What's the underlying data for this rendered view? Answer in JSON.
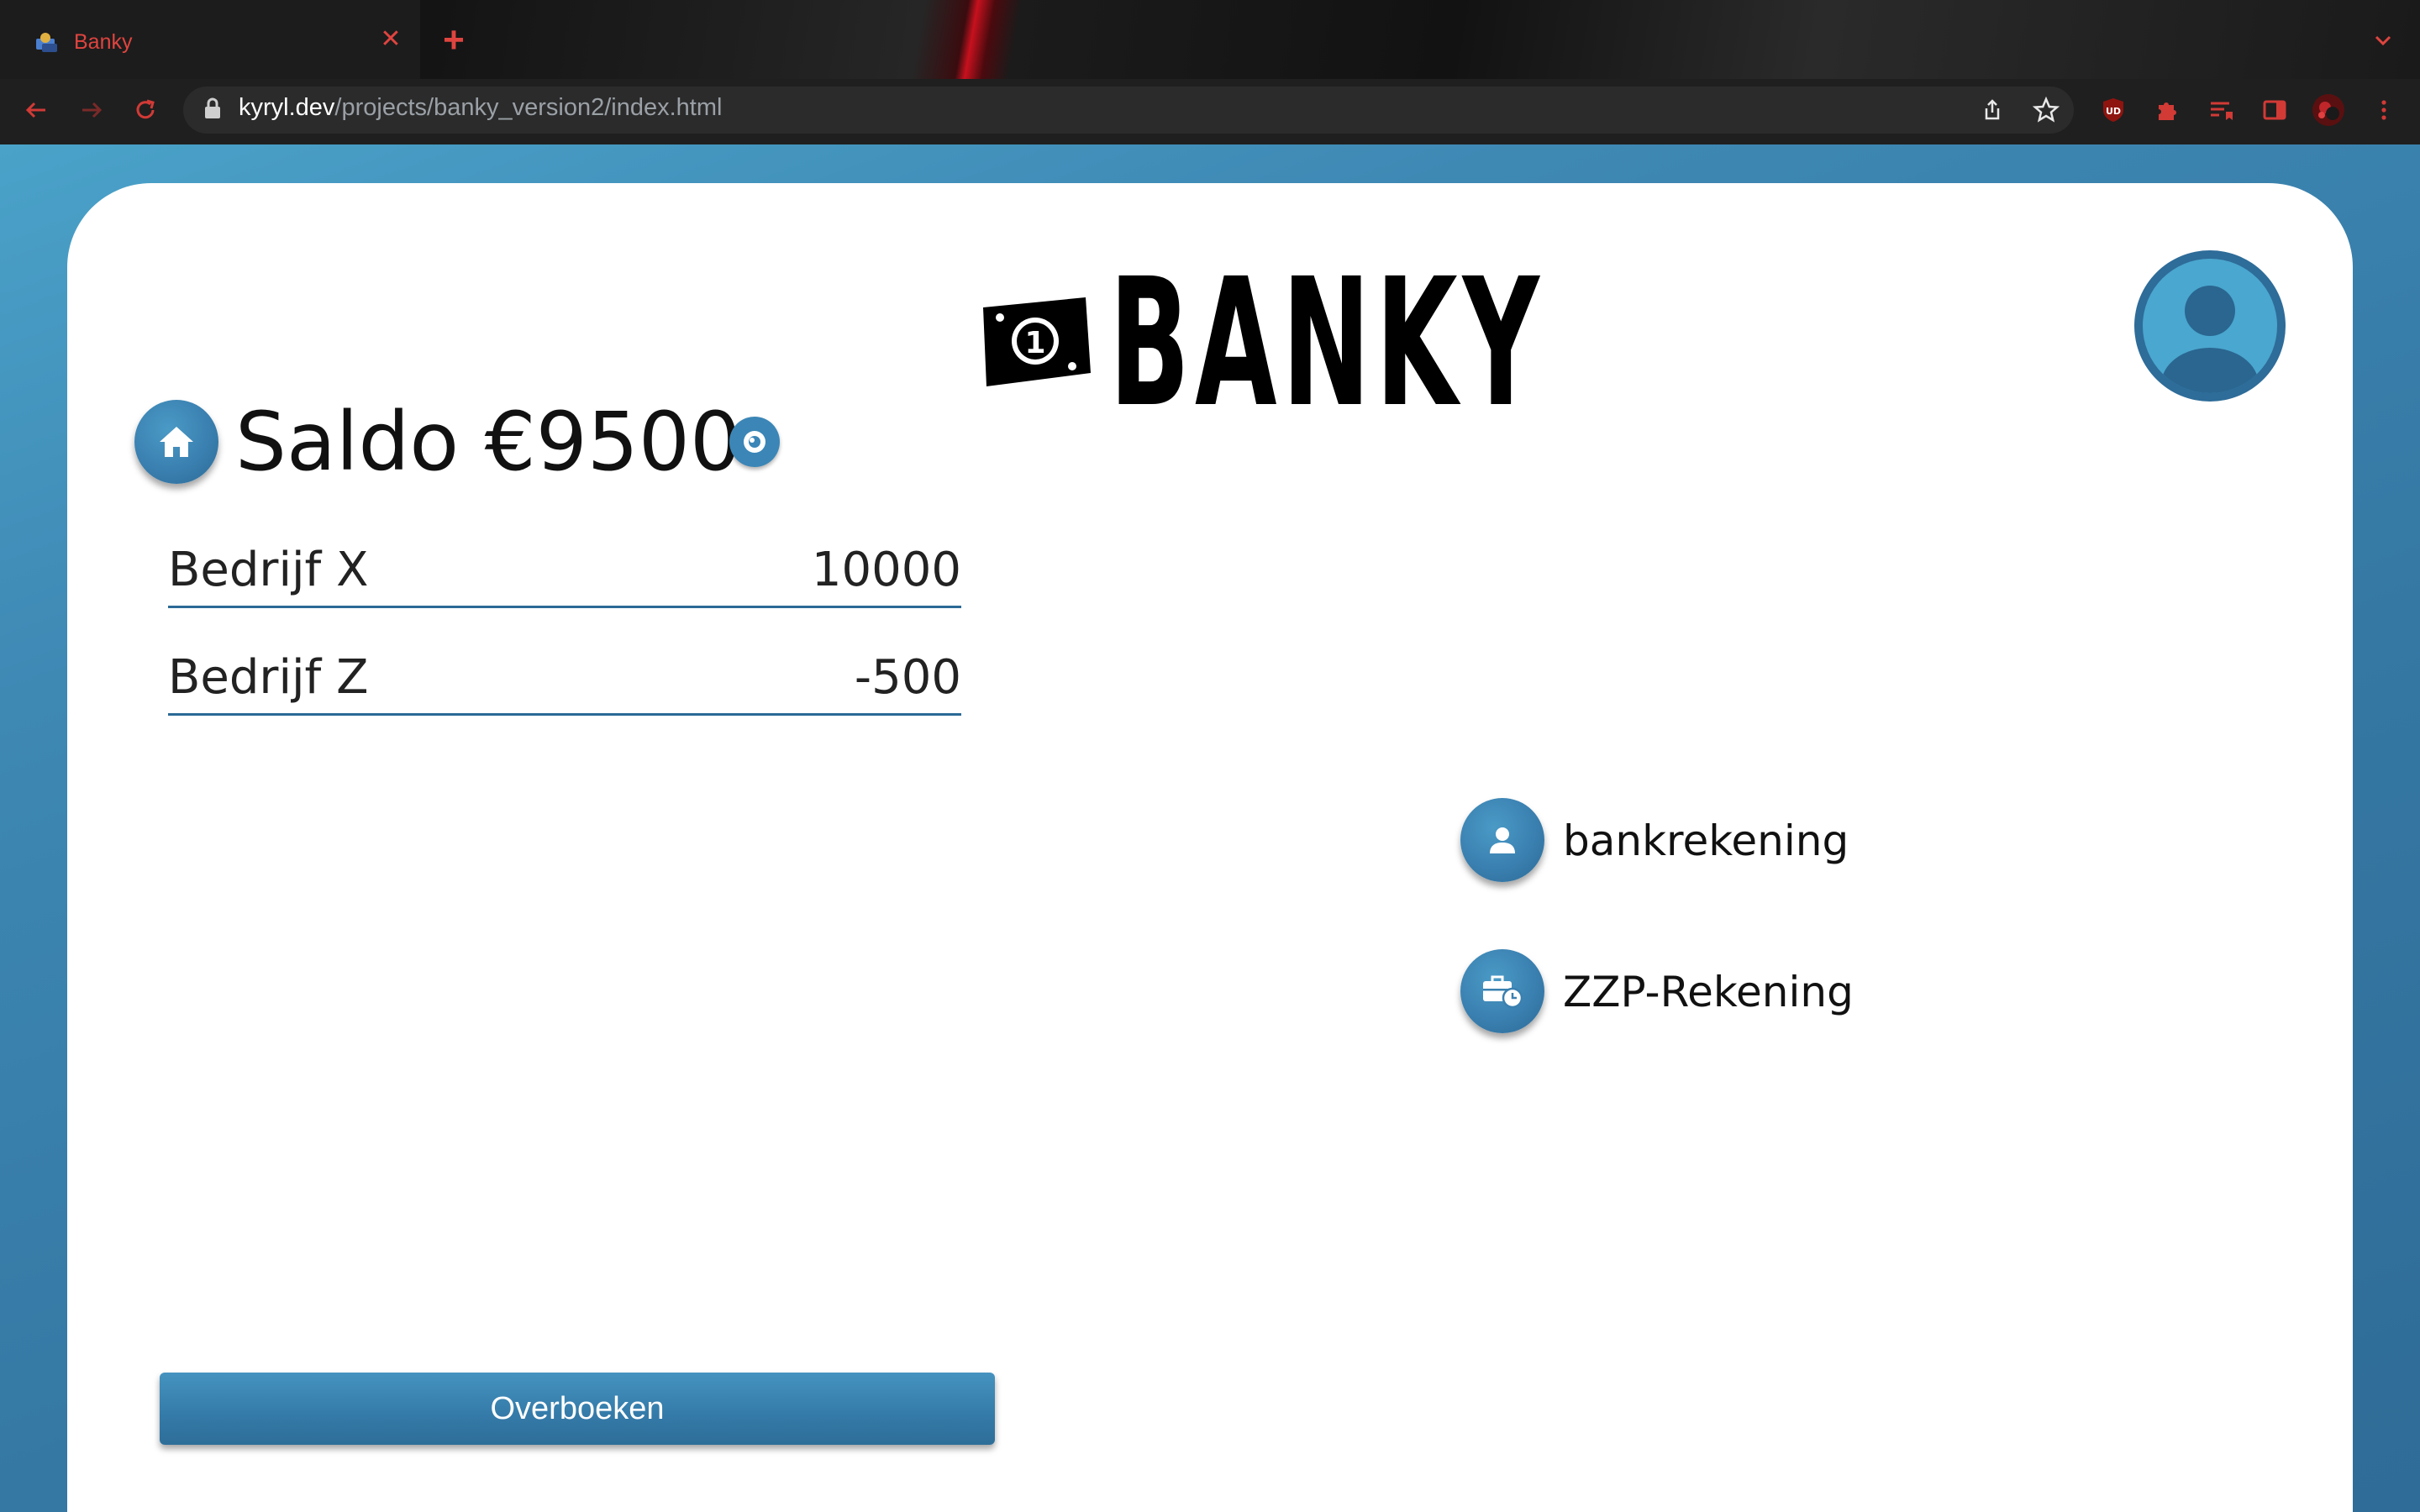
{
  "browser": {
    "tab_title": "Banky",
    "url_host": "kyryl.dev",
    "url_path": "/projects/banky_version2/index.html",
    "icons": [
      "back-icon",
      "forward-icon",
      "reload-icon",
      "lock-icon",
      "share-icon",
      "star-icon",
      "ublock-icon",
      "extensions-icon",
      "reading-list-icon",
      "side-panel-icon",
      "profile-icon",
      "menu-icon"
    ]
  },
  "app": {
    "logo_text": "BANKY",
    "balance_text": "Saldo €9500",
    "transactions": [
      {
        "name": "Bedrijf X",
        "amount": "10000"
      },
      {
        "name": "Bedrijf Z",
        "amount": "-500"
      }
    ],
    "accounts": [
      {
        "label": "bankrekening",
        "icon": "user-icon"
      },
      {
        "label": "ZZP-Rekening",
        "icon": "business-time-icon"
      }
    ],
    "transfer_label": "Overboeken"
  },
  "colors": {
    "accent": "#3a80b0",
    "page_bg": "#3e88b4",
    "tab_text": "#e0443f",
    "avatar_bg": "#4aa7cf"
  }
}
